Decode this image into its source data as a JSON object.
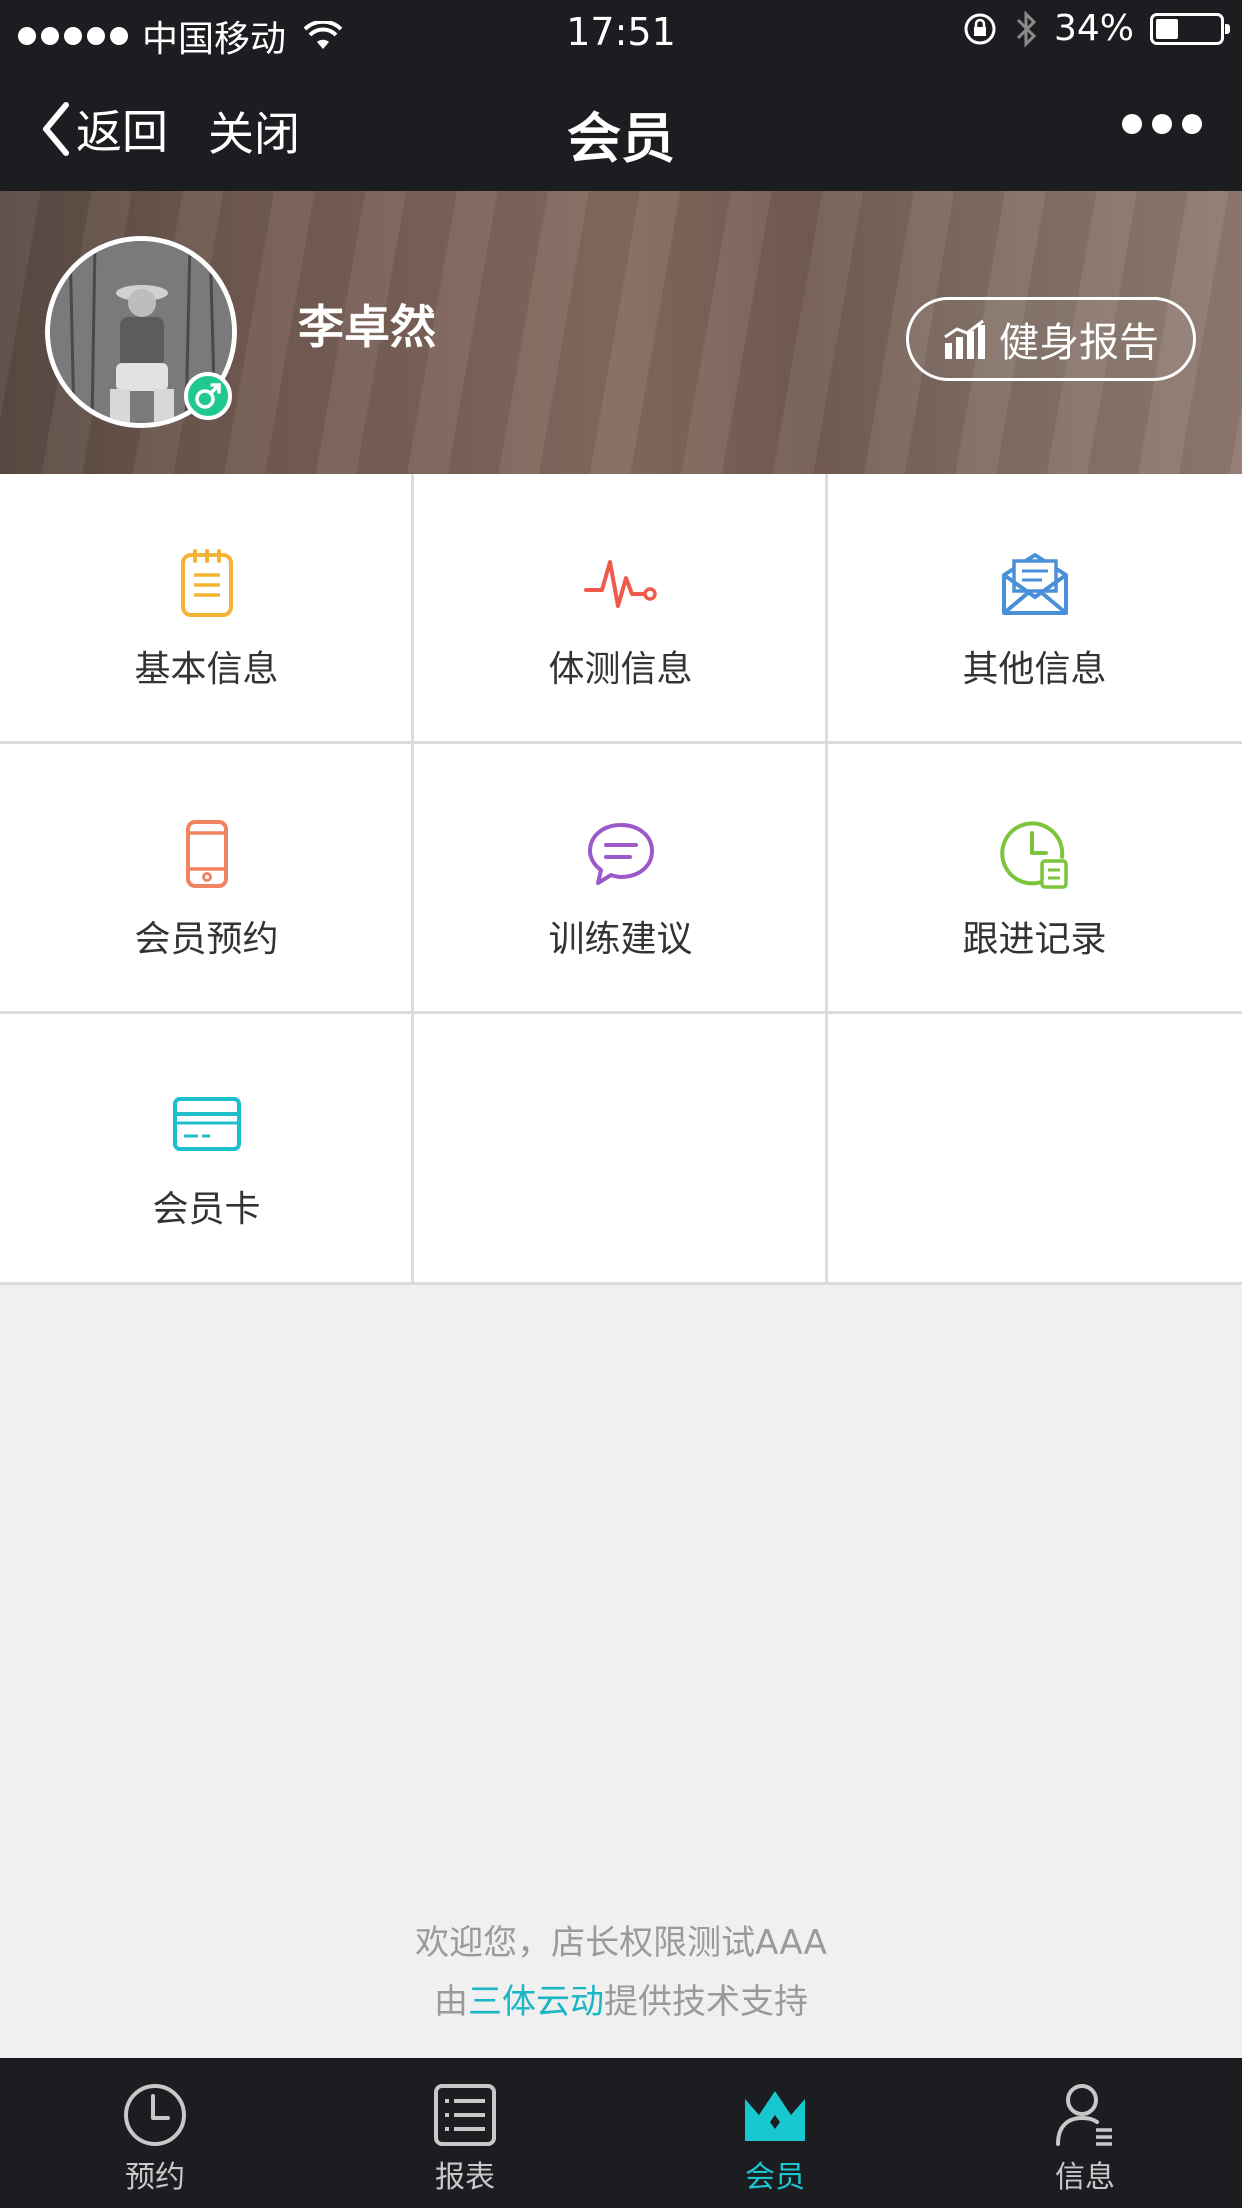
{
  "status_bar": {
    "carrier": "中国移动",
    "time": "17:51",
    "battery": "34%",
    "battery_level": 0.34
  },
  "nav": {
    "back_label": "返回",
    "close_label": "关闭",
    "title": "会员"
  },
  "profile": {
    "name": "李卓然",
    "gender_symbol": "♂",
    "report_button": "健身报告"
  },
  "grid": {
    "items": [
      {
        "label": "基本信息",
        "icon": "clipboard-icon",
        "color": "#f5b335"
      },
      {
        "label": "体测信息",
        "icon": "heartbeat-icon",
        "color": "#ef5a4a"
      },
      {
        "label": "其他信息",
        "icon": "envelope-icon",
        "color": "#4a90d9"
      },
      {
        "label": "会员预约",
        "icon": "phone-icon",
        "color": "#f08462"
      },
      {
        "label": "训练建议",
        "icon": "chat-bubble-icon",
        "color": "#9b59c9"
      },
      {
        "label": "跟进记录",
        "icon": "clock-document-icon",
        "color": "#7cc43c"
      },
      {
        "label": "会员卡",
        "icon": "card-icon",
        "color": "#1fbfc9"
      }
    ]
  },
  "footer": {
    "welcome": "欢迎您，店长权限测试AAA",
    "support_prefix": "由",
    "support_brand": "三体云动",
    "support_suffix": "提供技术支持",
    "brand_color": "#1ab6c4"
  },
  "tabbar": {
    "tabs": [
      {
        "label": "预约",
        "icon": "clock-icon"
      },
      {
        "label": "报表",
        "icon": "list-icon"
      },
      {
        "label": "会员",
        "icon": "crown-icon",
        "active": true
      },
      {
        "label": "信息",
        "icon": "person-icon"
      }
    ],
    "active_color": "#19c8cf"
  }
}
